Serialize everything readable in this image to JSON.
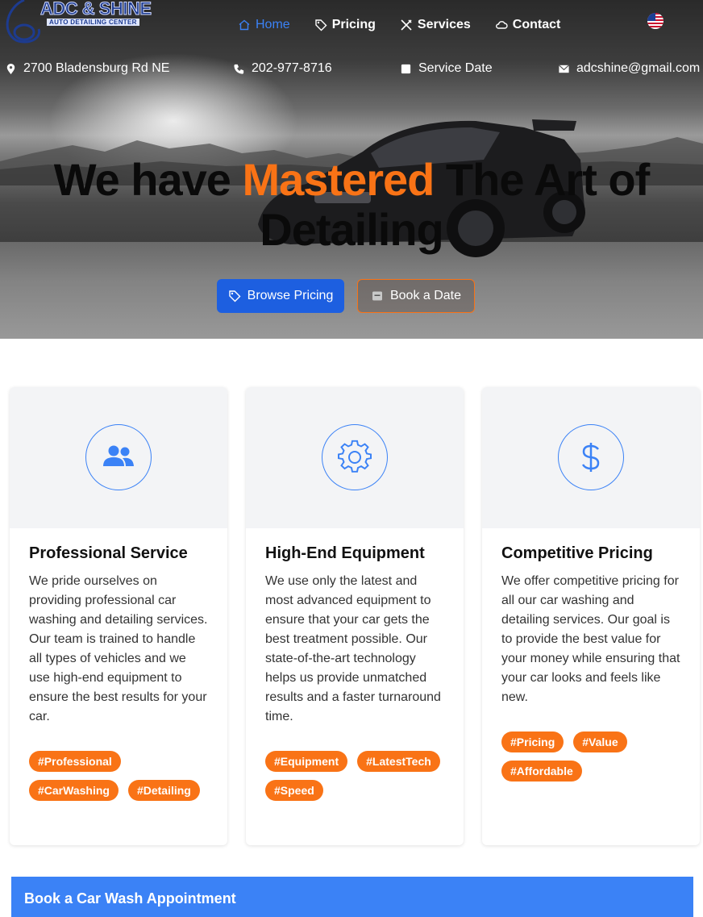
{
  "brand": {
    "name": "ADC & SHINE",
    "tagline": "AUTO DETAILING CENTER"
  },
  "nav": {
    "items": [
      {
        "label": "Home",
        "icon": "home-icon",
        "active": true
      },
      {
        "label": "Pricing",
        "icon": "tag-icon",
        "active": false
      },
      {
        "label": "Services",
        "icon": "tools-icon",
        "active": false
      },
      {
        "label": "Contact",
        "icon": "cloud-icon",
        "active": false
      }
    ],
    "language_flag": "us-flag-icon"
  },
  "info_bar": {
    "address": "2700 Bladensburg Rd NE",
    "phone": "202-977-8716",
    "service_date": "Service Date",
    "email": "adcshine@gmail.com"
  },
  "hero": {
    "headline_before": "We have ",
    "headline_accent": "Mastered",
    "headline_after": " The Art of Detailing",
    "primary_button": "Browse Pricing",
    "secondary_button": "Book a Date"
  },
  "cards": [
    {
      "icon": "users-icon",
      "title": "Professional Service",
      "text": "We pride ourselves on providing professional car washing and detailing services. Our team is trained to handle all types of vehicles and we use high-end equipment to ensure the best results for your car.",
      "tags": [
        "#Professional",
        "#CarWashing",
        "#Detailing"
      ]
    },
    {
      "icon": "gear-icon",
      "title": "High-End Equipment",
      "text": "We use only the latest and most advanced equipment to ensure that your car gets the best treatment possible. Our state-of-the-art technology helps us provide unmatched results and a faster turnaround time.",
      "tags": [
        "#Equipment",
        "#LatestTech",
        "#Speed"
      ]
    },
    {
      "icon": "dollar-icon",
      "title": "Competitive Pricing",
      "text": "We offer competitive pricing for all our car washing and detailing services. Our goal is to provide the best value for your money while ensuring that your car looks and feels like new.",
      "tags": [
        "#Pricing",
        "#Value",
        "#Affordable"
      ]
    }
  ],
  "booking": {
    "title": "Book a Car Wash Appointment"
  },
  "colors": {
    "accent_orange": "#f97316",
    "primary_blue": "#1d5fe0",
    "link_blue": "#3b82f6",
    "card_top_bg": "#f3f4f6"
  }
}
